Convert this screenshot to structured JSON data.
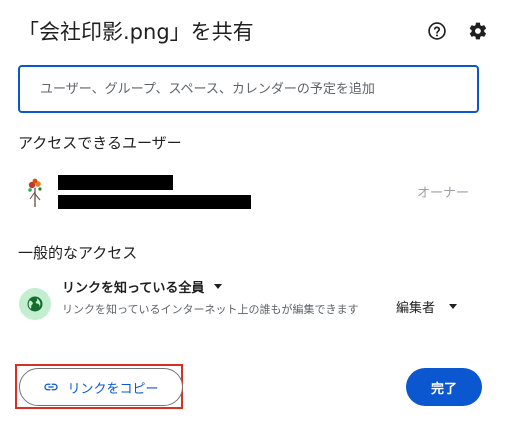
{
  "dialog": {
    "title": "「会社印影.png」を共有",
    "help_icon": "help-circle-icon",
    "settings_icon": "gear-icon"
  },
  "search": {
    "placeholder": "ユーザー、グループ、スペース、カレンダーの予定を追加"
  },
  "people_section": {
    "title": "アクセスできるユーザー",
    "users": [
      {
        "name": "",
        "email": "",
        "role": "オーナー",
        "redacted": true
      }
    ]
  },
  "general_access": {
    "title": "一般的なアクセス",
    "selected": "リンクを知っている全員",
    "description": "リンクを知っているインターネット上の誰もが編集できます",
    "role": "編集者",
    "icon": "globe-icon"
  },
  "footer": {
    "copy_link_label": "リンクをコピー",
    "done_label": "完了"
  },
  "colors": {
    "accent": "#0b57d0",
    "globe_bg": "#c4eed0",
    "highlight": "#d93025"
  }
}
